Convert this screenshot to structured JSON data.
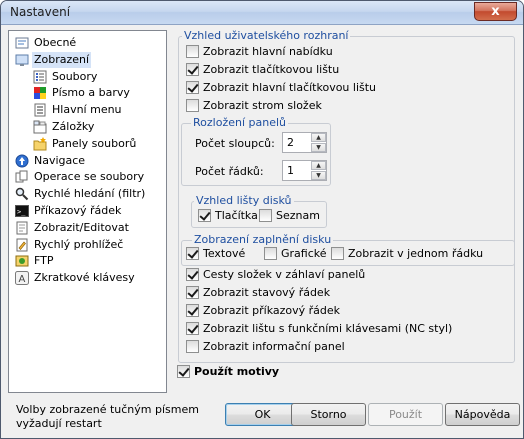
{
  "window": {
    "title": "Nastavení",
    "close_glyph": "x"
  },
  "tree": [
    {
      "label": "Obecné",
      "icon": "settings-icon",
      "level": 0
    },
    {
      "label": "Zobrazení",
      "icon": "display-icon",
      "level": 0,
      "selected": true
    },
    {
      "label": "Soubory",
      "icon": "list-icon",
      "level": 1
    },
    {
      "label": "Písmo a barvy",
      "icon": "colors-icon",
      "level": 1
    },
    {
      "label": "Hlavní menu",
      "icon": "menu-icon",
      "level": 1
    },
    {
      "label": "Záložky",
      "icon": "tabs-icon",
      "level": 1
    },
    {
      "label": "Panely souborů",
      "icon": "folder-star-icon",
      "level": 1
    },
    {
      "label": "Navigace",
      "icon": "navigation-icon",
      "level": 0
    },
    {
      "label": "Operace se soubory",
      "icon": "file-operations-icon",
      "level": 0
    },
    {
      "label": "Rychlé hledání (filtr)",
      "icon": "search-icon",
      "level": 0
    },
    {
      "label": "Příkazový řádek",
      "icon": "command-line-icon",
      "level": 0
    },
    {
      "label": "Zobrazit/Editovat",
      "icon": "view-edit-icon",
      "level": 0
    },
    {
      "label": "Rychlý prohlížeč",
      "icon": "quick-view-icon",
      "level": 0
    },
    {
      "label": "FTP",
      "icon": "ftp-icon",
      "level": 0
    },
    {
      "label": "Zkratkové klávesy",
      "icon": "hotkeys-icon",
      "level": 0
    }
  ],
  "ui_section": {
    "legend": "Vzhled uživatelského rozhraní",
    "options": [
      {
        "label": "Zobrazit hlavní nabídku",
        "checked": false
      },
      {
        "label": "Zobrazit tlačítkovou lištu",
        "checked": true
      },
      {
        "label": "Zobrazit hlavní tlačítkovou lištu",
        "checked": true
      },
      {
        "label": "Zobrazit strom složek",
        "checked": false
      }
    ]
  },
  "panel_layout": {
    "legend": "Rozložení panelů",
    "columns_label": "Počet sloupců:",
    "columns_value": "2",
    "rows_label": "Počet řádků:",
    "rows_value": "1"
  },
  "drive_bar": {
    "legend": "Vzhled lišty disků",
    "options": [
      {
        "label": "Tlačítka",
        "checked": true
      },
      {
        "label": "Seznam",
        "checked": false
      }
    ]
  },
  "disk_usage": {
    "legend": "Zobrazení zaplnění disku",
    "options": [
      {
        "label": "Textové",
        "checked": true
      },
      {
        "label": "Grafické",
        "checked": false
      },
      {
        "label": "Zobrazit v jednom řádku",
        "checked": false
      }
    ]
  },
  "misc_options": [
    {
      "label": "Cesty složek v záhlaví panelů",
      "checked": true
    },
    {
      "label": "Zobrazit stavový řádek",
      "checked": true
    },
    {
      "label": "Zobrazit příkazový řádek",
      "checked": true
    },
    {
      "label": "Zobrazit lištu s funkčními klávesami (NC styl)",
      "checked": true
    },
    {
      "label": "Zobrazit informační panel",
      "checked": false
    }
  ],
  "use_themes": {
    "label": "Použít motivy",
    "checked": true
  },
  "note": "Volby zobrazené tučným písmem vyžadují restart",
  "buttons": {
    "ok": "OK",
    "cancel": "Storno",
    "apply": "Použít",
    "help": "Nápověda"
  },
  "spin_glyphs": {
    "up": "▲",
    "down": "▼"
  }
}
